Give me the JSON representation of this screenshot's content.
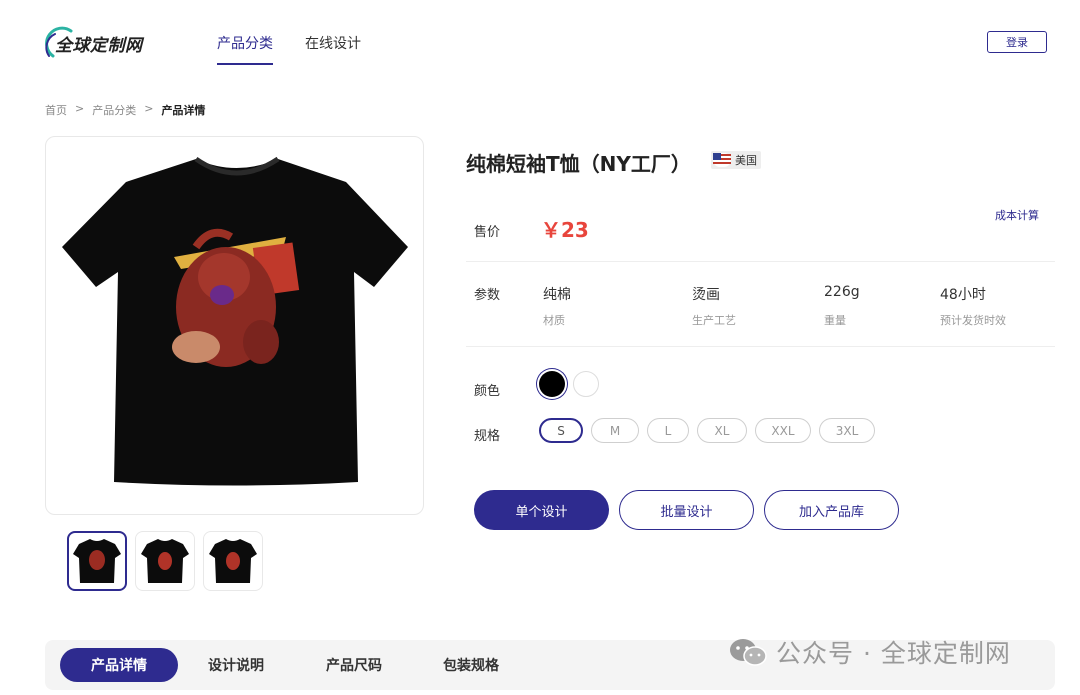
{
  "header": {
    "logo_text": "全球定制网",
    "nav": [
      {
        "label": "产品分类",
        "active": true
      },
      {
        "label": "在线设计",
        "active": false
      }
    ],
    "login_label": "登录"
  },
  "breadcrumb": {
    "home": "首页",
    "sep": ">",
    "category": "产品分类",
    "current": "产品详情"
  },
  "product": {
    "title": "纯棉短袖T恤（NY工厂）",
    "origin": "美国",
    "cost_link": "成本计算",
    "price_label": "售价",
    "price": "￥23",
    "params_label": "参数",
    "params": [
      {
        "value": "纯棉",
        "key": "材质"
      },
      {
        "value": "烫画",
        "key": "生产工艺"
      },
      {
        "value": "226g",
        "key": "重量"
      },
      {
        "value": "48小时",
        "key": "预计发货时效"
      }
    ],
    "color_label": "颜色",
    "colors": [
      {
        "name": "black",
        "hex": "#000000",
        "selected": true
      },
      {
        "name": "white",
        "hex": "#ffffff",
        "selected": false
      }
    ],
    "size_label": "规格",
    "sizes": [
      "S",
      "M",
      "L",
      "XL",
      "XXL",
      "3XL"
    ],
    "selected_size": "S",
    "thumbnails": 3
  },
  "actions": {
    "single_design": "单个设计",
    "batch_design": "批量设计",
    "add_library": "加入产品库"
  },
  "tabs": [
    {
      "label": "产品详情",
      "active": true
    },
    {
      "label": "设计说明",
      "active": false
    },
    {
      "label": "产品尺码",
      "active": false
    },
    {
      "label": "包装规格",
      "active": false
    }
  ],
  "watermark": "公众号 · 全球定制网",
  "colors": {
    "accent": "#2e2b8f",
    "price": "#e8453c"
  }
}
